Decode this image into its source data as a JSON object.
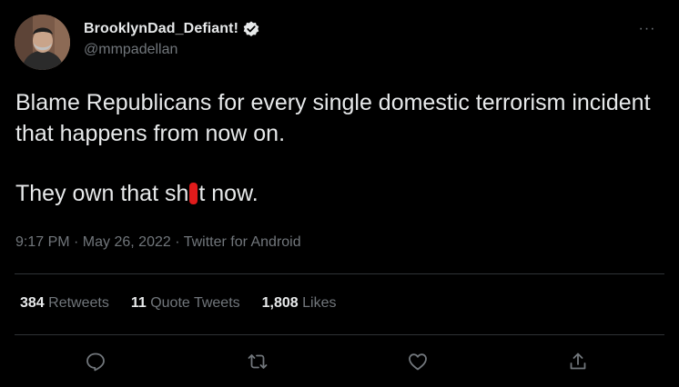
{
  "author": {
    "display_name": "BrooklynDad_Defiant!",
    "handle": "@mmpadellan",
    "avatar_icon": "user-avatar-photo",
    "verified_icon": "verified-badge-icon"
  },
  "menu": {
    "more_label": "···",
    "more_icon": "more-options-icon"
  },
  "tweet": {
    "line1": "Blame Republicans for every single domestic terrorism incident that happens from now on.",
    "line2_before": "They own that sh",
    "line2_after": "t now.",
    "timestamp": "9:17 PM · May 26, 2022 · Twitter for Android"
  },
  "stats": {
    "retweets_count": "384",
    "retweets_label": " Retweets",
    "quotes_count": "11",
    "quotes_label": " Quote Tweets",
    "likes_count": "1,808",
    "likes_label": " Likes"
  },
  "actions": {
    "reply_icon": "reply-icon",
    "retweet_icon": "retweet-icon",
    "like_icon": "like-icon",
    "share_icon": "share-icon"
  },
  "colors": {
    "background": "#000000",
    "text": "#e7e9ea",
    "secondary": "#71767b",
    "divider": "#2f3336",
    "censor_mark": "#e01b1b"
  }
}
